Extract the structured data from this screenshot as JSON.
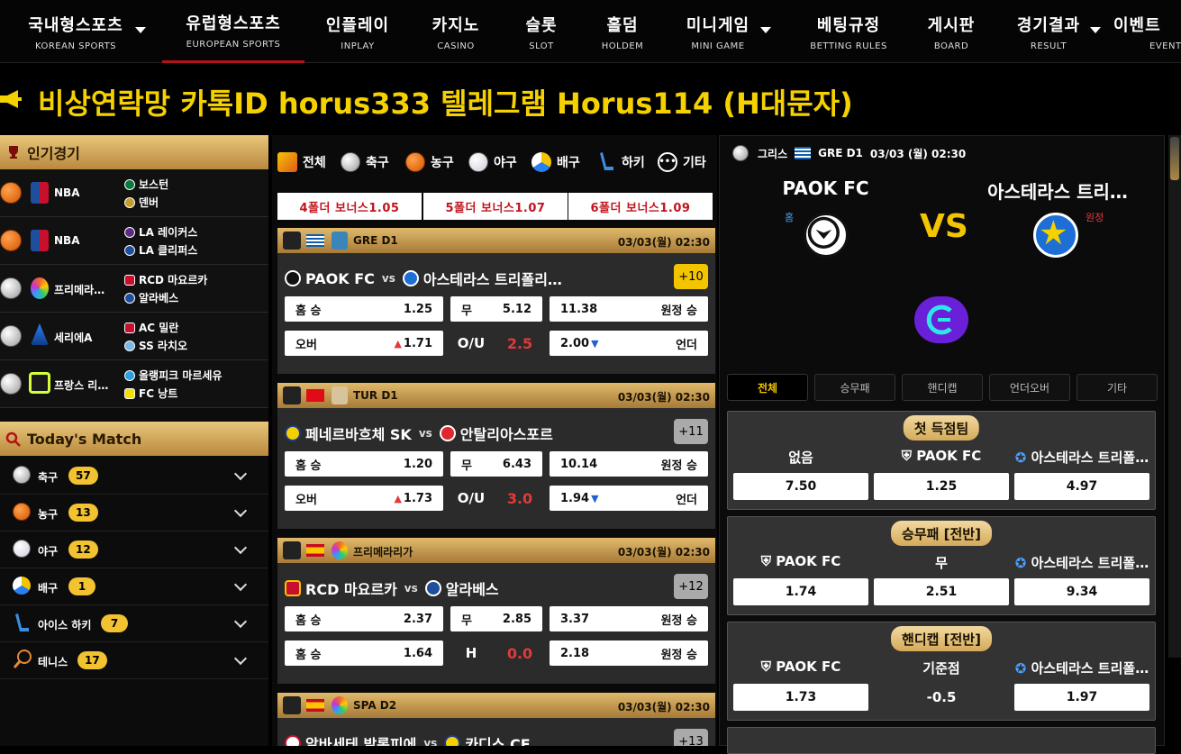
{
  "nav": [
    {
      "ko": "국내형스포츠",
      "en": "KOREAN SPORTS",
      "caret": true
    },
    {
      "ko": "유럽형스포츠",
      "en": "EUROPEAN SPORTS",
      "active": true
    },
    {
      "ko": "인플레이",
      "en": "INPLAY"
    },
    {
      "ko": "카지노",
      "en": "CASINO"
    },
    {
      "ko": "슬롯",
      "en": "SLOT"
    },
    {
      "ko": "홀덤",
      "en": "HOLDEM"
    },
    {
      "ko": "미니게임",
      "en": "MINI GAME",
      "caret": true
    },
    {
      "ko": "베팅규정",
      "en": "BETTING RULES"
    },
    {
      "ko": "게시판",
      "en": "BOARD"
    },
    {
      "ko": "경기결과",
      "en": "RESULT",
      "caret": true
    },
    {
      "ko": "이벤트",
      "en": "EVENT"
    }
  ],
  "notice": "비상연락망 카톡ID horus333 텔레그램 Horus114 (H대문자)",
  "popular": {
    "title": "인기경기",
    "rows": [
      {
        "sport": "basket",
        "league": "NBA",
        "home": "보스턴",
        "away": "덴버"
      },
      {
        "sport": "basket",
        "league": "NBA",
        "home": "LA 레이커스",
        "away": "LA 클리퍼스"
      },
      {
        "sport": "soccer",
        "league": "프리메라…",
        "home": "RCD 마요르카",
        "away": "알라베스"
      },
      {
        "sport": "soccer",
        "league": "세리에A",
        "home": "AC 밀란",
        "away": "SS 라치오"
      },
      {
        "sport": "soccer",
        "league": "프랑스 리…",
        "home": "올랭피크 마르세유",
        "away": "FC 낭트"
      }
    ]
  },
  "today": {
    "title": "Today's Match",
    "rows": [
      {
        "label": "축구",
        "count": "57",
        "icon": "soccer-ball-icon"
      },
      {
        "label": "농구",
        "count": "13",
        "icon": "basketball-icon"
      },
      {
        "label": "야구",
        "count": "12",
        "icon": "baseball-icon"
      },
      {
        "label": "배구",
        "count": "1",
        "icon": "volleyball-icon"
      },
      {
        "label": "아이스 하키",
        "count": "7",
        "icon": "hockey-stick-icon"
      },
      {
        "label": "테니스",
        "count": "17",
        "icon": "tennis-racket-icon"
      }
    ]
  },
  "filters": [
    "전체",
    "축구",
    "농구",
    "야구",
    "배구",
    "하키",
    "기타"
  ],
  "bonus": [
    "4폴더 보너스1.05",
    "5폴더 보너스1.07",
    "6폴더 보너스1.09"
  ],
  "cards": [
    {
      "flag": "greece",
      "league": "GRE D1",
      "time": "03/03(월) 02:30",
      "home": "PAOK FC",
      "away": "아스테라스 트리폴리…",
      "more": "+10",
      "gold": true,
      "row1": {
        "l": "홈 승",
        "lv": "1.25",
        "m": "무",
        "mv": "5.12",
        "rv": "11.38",
        "r": "원정 승"
      },
      "row2": {
        "l": "오버",
        "lv": "1.71",
        "m": "O/U",
        "mv": "2.5",
        "rv": "2.00",
        "r": "언더"
      }
    },
    {
      "flag": "turkey",
      "league": "TUR D1",
      "time": "03/03(월) 02:30",
      "home": "페네르바흐체 SK",
      "away": "안탈리아스포르",
      "more": "+11",
      "row1": {
        "l": "홈 승",
        "lv": "1.20",
        "m": "무",
        "mv": "6.43",
        "rv": "10.14",
        "r": "원정 승"
      },
      "row2": {
        "l": "오버",
        "lv": "1.73",
        "m": "O/U",
        "mv": "3.0",
        "rv": "1.94",
        "r": "언더"
      }
    },
    {
      "flag": "spain",
      "league": "프리메라리가",
      "time": "03/03(월) 02:30",
      "home": "RCD 마요르카",
      "away": "알라베스",
      "more": "+12",
      "row1": {
        "l": "홈 승",
        "lv": "2.37",
        "m": "무",
        "mv": "2.85",
        "rv": "3.37",
        "r": "원정 승"
      },
      "row2": {
        "l": "홈 승",
        "lv": "1.64",
        "m": "H",
        "mv": "0.0",
        "rv": "2.18",
        "r": "원정 승"
      }
    },
    {
      "flag": "spain",
      "league": "SPA D2",
      "time": "03/03(월) 02:30",
      "home": "알바세테 발롬피에",
      "away": "카디스 CF",
      "more": "+13"
    }
  ],
  "detail": {
    "country": "그리스",
    "league": "GRE D1",
    "time": "03/03 (월) 02:30",
    "home": "PAOK FC",
    "away": "아스테라스 트리…",
    "home_tag": "홈",
    "away_tag": "원정",
    "vs": "VS",
    "tabs": [
      "전체",
      "승무패",
      "핸디캡",
      "언더오버",
      "기타"
    ],
    "markets": [
      {
        "title": "첫 득점팀",
        "cols": [
          "없음",
          "PAOK FC",
          "아스테라스 트리폴…"
        ],
        "odds": [
          "7.50",
          "1.25",
          "4.97"
        ]
      },
      {
        "title": "승무패 [전반]",
        "cols": [
          "PAOK FC",
          "무",
          "아스테라스 트리폴…"
        ],
        "odds": [
          "1.74",
          "2.51",
          "9.34"
        ]
      },
      {
        "title": "핸디캡 [전반]",
        "cols": [
          "PAOK FC",
          "기준점",
          "아스테라스 트리폴…"
        ],
        "odds": [
          "1.73",
          "-0.5",
          "1.97"
        ]
      }
    ]
  },
  "colors": {
    "gold": "#f2c500",
    "accent": "#b2121a",
    "bonus_text": "#c0151e"
  }
}
